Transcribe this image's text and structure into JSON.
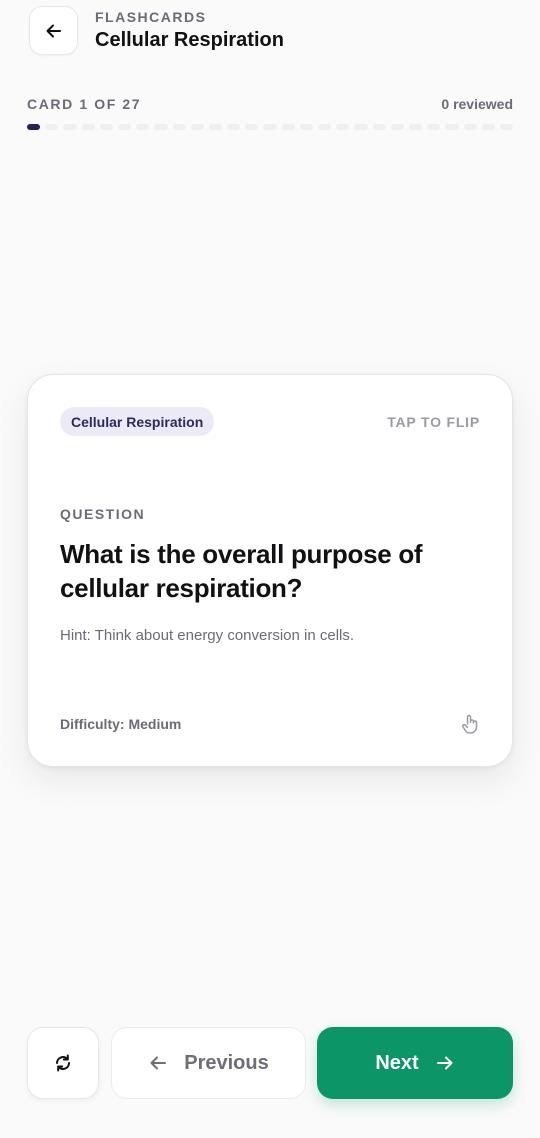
{
  "header": {
    "kicker": "FLASHCARDS",
    "title": "Cellular Respiration",
    "back_icon": "arrow-left-icon"
  },
  "progress": {
    "label": "CARD 1 OF 27",
    "reviewed": "0 reviewed",
    "current": 1,
    "total": 27
  },
  "card": {
    "topic": "Cellular Respiration",
    "flip_hint": "TAP TO FLIP",
    "section_label": "QUESTION",
    "question": "What is the overall purpose of cellular respiration?",
    "hint": "Hint: Think about energy conversion in cells.",
    "difficulty": "Difficulty: Medium",
    "tap_icon": "hand-pointer-icon"
  },
  "controls": {
    "shuffle_icon": "refresh-icon",
    "previous_label": "Previous",
    "next_label": "Next"
  },
  "colors": {
    "accent": "#0c9668",
    "progress_active": "#25215a",
    "chip_bg": "#eceaf7"
  }
}
